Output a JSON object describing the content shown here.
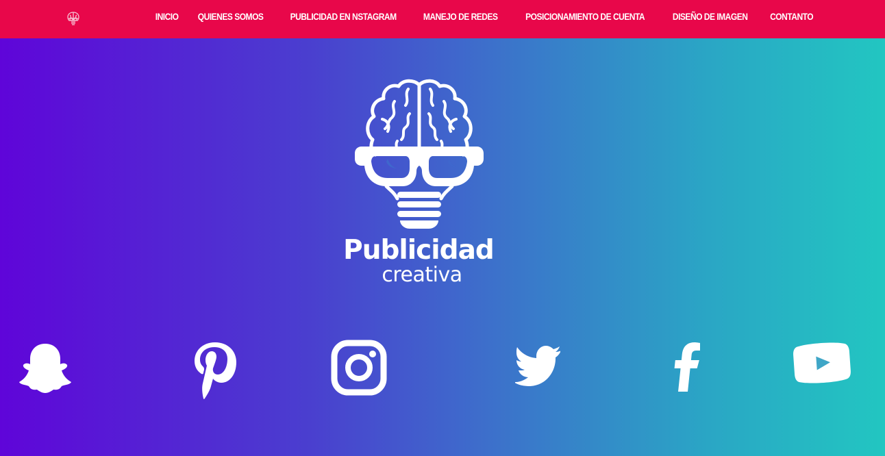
{
  "nav": {
    "logo_icon": "brain-skull-icon",
    "items": [
      {
        "label": "INICIO"
      },
      {
        "label": "QUIENES SOMOS"
      },
      {
        "label": "PUBLICIDAD EN NSTAGRAM"
      },
      {
        "label": "MANEJO DE REDES"
      },
      {
        "label": "POSICIONAMIENTO DE CUENTA"
      },
      {
        "label": "DISEÑO DE IMAGEN"
      },
      {
        "label": "CONTANTO"
      }
    ]
  },
  "hero": {
    "logo_icon": "brain-lightbulb-glasses-icon",
    "brand_name": "Publicidad",
    "brand_sub": "creativa"
  },
  "social": [
    {
      "icon": "snapchat-icon"
    },
    {
      "icon": "pinterest-icon"
    },
    {
      "icon": "instagram-icon"
    },
    {
      "icon": "twitter-icon"
    },
    {
      "icon": "facebook-icon"
    },
    {
      "icon": "youtube-icon"
    }
  ],
  "colors": {
    "navbar": "#e8074a",
    "gradient_start": "#5f05d9",
    "gradient_end": "#22c6c1",
    "foreground": "#ffffff"
  }
}
